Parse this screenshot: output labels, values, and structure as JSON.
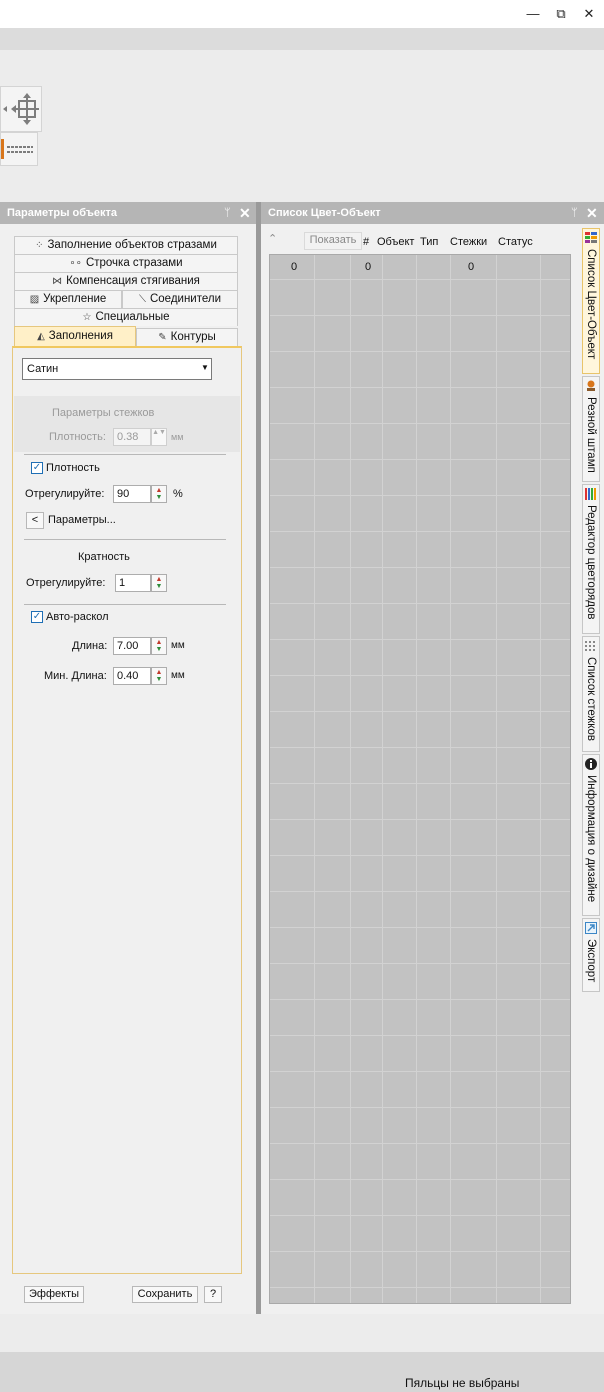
{
  "window": {
    "minimize": "—",
    "restore": "⧉",
    "close": "✕"
  },
  "left_panel": {
    "title": "Параметры объекта",
    "pin": "ᛘ",
    "close": "✕",
    "tabs": {
      "rhinestone_fill": "Заполнение объектов стразами",
      "rhinestone_line": "Строчка стразами",
      "pull_comp": "Компенсация стягивания",
      "underlay": "Укрепление",
      "connectors": "Соединители",
      "special": "Специальные",
      "fills": "Заполнения",
      "outlines": "Контуры"
    },
    "fill_type": {
      "selected": "Сатин"
    },
    "stitch_params": {
      "heading": "Параметры стежков",
      "density_label": "Плотность:",
      "density_value": "0.38",
      "unit": "мм"
    },
    "density": {
      "checkbox_label": "Плотность",
      "checked": true,
      "adjust_label": "Отрегулируйте:",
      "adjust_value": "90",
      "unit": "%",
      "params_button_arrow": "<",
      "params_button_label": "Параметры..."
    },
    "multiplicity": {
      "heading": "Кратность",
      "adjust_label": "Отрегулируйте:",
      "adjust_value": "1"
    },
    "auto_split": {
      "checkbox_label": "Авто-раскол",
      "checked": true,
      "length_label": "Длина:",
      "length_value": "7.00",
      "min_length_label": "Мин. Длина:",
      "min_length_value": "0.40",
      "unit": "мм"
    },
    "footer": {
      "effects": "Эффекты",
      "save": "Сохранить",
      "help": "?"
    }
  },
  "right_panel": {
    "title": "Список Цвет-Объект",
    "pin": "ᛘ",
    "close": "✕",
    "show_button": "Показать",
    "collapse_icon": "⌃",
    "columns": [
      "#",
      "Объект",
      "Тип",
      "Стежки",
      "Статус"
    ],
    "first_row": [
      "0",
      "0",
      "0"
    ]
  },
  "side_tabs": [
    "Список Цвет-Объект",
    "Резной штамп",
    "Редактор цветорядов",
    "Список стежков",
    "Информация о дизайне",
    "Экспорт"
  ],
  "status": {
    "hoop": "Пяльцы не выбраны"
  }
}
